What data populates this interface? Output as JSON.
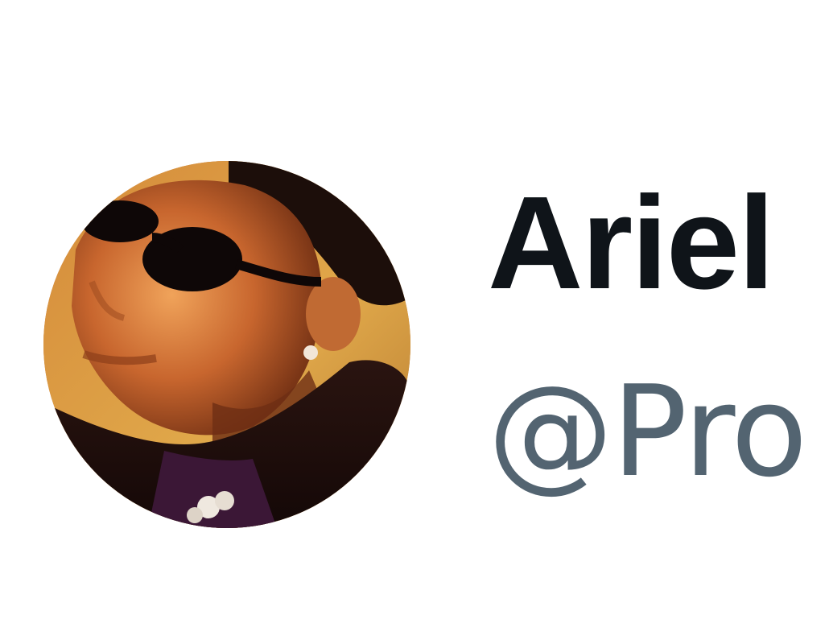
{
  "profile": {
    "display_name": "Ariel",
    "handle": "@Pro",
    "avatar_icon": "profile-photo"
  },
  "colors": {
    "background": "#ffffff",
    "name_text": "#0f1419",
    "handle_text": "#536471"
  }
}
